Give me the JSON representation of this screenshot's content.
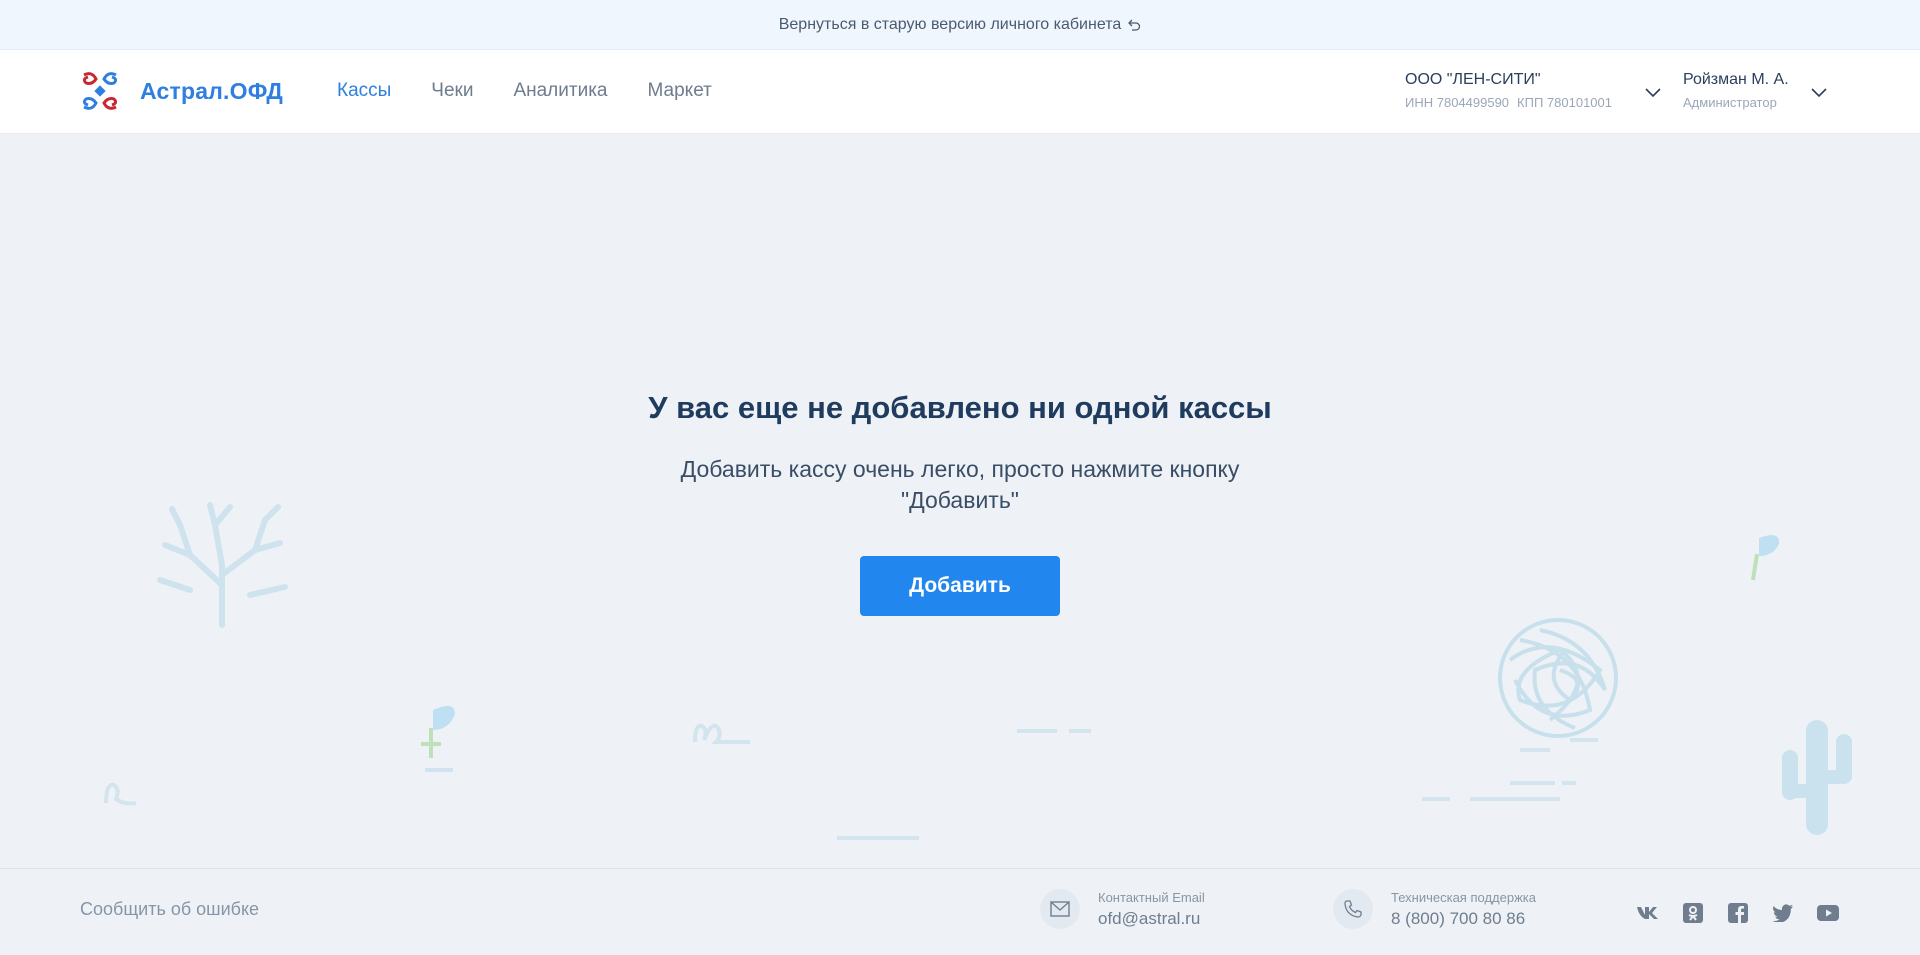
{
  "topbar": {
    "back_link": "Вернуться в старую версию личного кабинета"
  },
  "header": {
    "logo_text": "Астрал.ОФД",
    "nav": [
      {
        "label": "Кассы",
        "active": true
      },
      {
        "label": "Чеки"
      },
      {
        "label": "Аналитика"
      },
      {
        "label": "Маркет"
      }
    ],
    "org": {
      "name": "ООО \"ЛЕН-СИТИ\"",
      "inn": "ИНН 7804499590",
      "kpp": "КПП 780101001"
    },
    "user": {
      "name": "Ройзман М. А.",
      "role": "Администратор"
    }
  },
  "empty_state": {
    "title": "У вас еще не добавлено ни одной кассы",
    "description": "Добавить кассу очень легко, просто нажмите кнопку \"Добавить\"",
    "button": "Добавить"
  },
  "footer": {
    "report_link": "Сообщить об ошибке",
    "email_label": "Контактный Email",
    "email": "ofd@astral.ru",
    "support_label": "Техническая поддержка",
    "phone": "8 (800) 700 80 86",
    "socials": [
      "vk-icon",
      "odnoklassniki-icon",
      "facebook-icon",
      "twitter-icon",
      "youtube-icon"
    ]
  },
  "colors": {
    "accent": "#2f7fe0",
    "button": "#2186ee",
    "background": "#eef2f6"
  }
}
